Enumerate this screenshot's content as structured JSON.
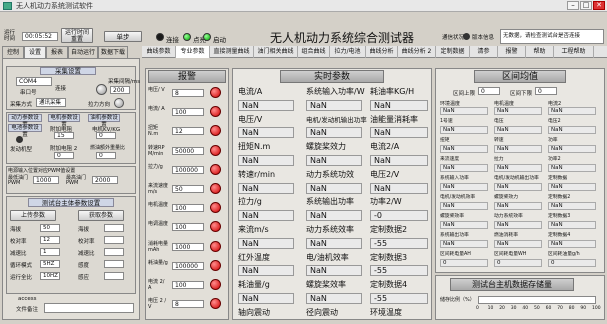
{
  "window": {
    "title": "无人机动力系统测试软件",
    "min": "–",
    "max": "□",
    "close": "✕"
  },
  "top": {
    "run_time_label": "运行时间",
    "run_time_value": "00:05:52",
    "reset_label": "运行时间 重置",
    "single_label": "单步",
    "connect_label": "连接",
    "light_label": "点亮",
    "start_label": "启动",
    "title": "无人机动力系统综合测试器",
    "comm_label": "通信状况",
    "version_label": "版本信息",
    "version_value": "无数据，请检查测试台是否连接"
  },
  "colors": {
    "accent": "#1aa41a",
    "alarm": "#d00000"
  },
  "left_tabs": [
    "控制",
    "设置",
    "报表",
    "自动运行",
    "数据下载"
  ],
  "right_tabs": [
    "曲线参数",
    "专业参数",
    "直接测量曲线",
    "油门相关曲线",
    "组合曲线",
    "拉力/电池",
    "曲线分析",
    "曲线分析 2",
    "定制数据",
    "清参",
    "报警",
    "帮助",
    "工程帮助"
  ],
  "left": {
    "sampling_title": "采集设置",
    "port_label": "串口号",
    "port_value": "COM4",
    "interval_label": "采集间隔/ms",
    "interval_value": "200",
    "connect_label": "连接",
    "mode_label": "采集方式",
    "mode_value": "通讯采集",
    "pull_label": "拉力方向",
    "power_title": "动力参数设置",
    "motor_label": "电机参数设置",
    "gas_label": "油机参数设置",
    "battery_label": "电池参数设置",
    "ext_pole_label": "附加电阻",
    "pole_value": "15",
    "kv_label": "电机KV/KG",
    "kv_value": "0",
    "engine_label": "发动机型",
    "ratio_label": "附加电阻 2",
    "ratio_value": "0",
    "gear_label": "燃油额外重量比",
    "gear_value": "0",
    "pwm_title": "电源输入位置对应PWM值设置",
    "pwm1_label": "最低油门 PWM",
    "pwm1_value": "1000",
    "pwm2_label": "最高油门 PWM",
    "pwm2_value": "2000",
    "eng_title": "测试台主体参数设置",
    "up_label": "上传参数",
    "down_label": "获取参数",
    "params": [
      {
        "l": "海拔",
        "v": "50"
      },
      {
        "l": "校对率",
        "v": "12"
      },
      {
        "l": "减速比",
        "v": "1"
      },
      {
        "l": "循环模式",
        "v": "5HZ"
      },
      {
        "l": "运行全比",
        "v": "10HZ"
      }
    ],
    "params2": [
      {
        "l": "海拔",
        "v": ""
      },
      {
        "l": "校对率",
        "v": ""
      },
      {
        "l": "减速比",
        "v": ""
      },
      {
        "l": "感度",
        "v": ""
      },
      {
        "l": "感应",
        "v": ""
      }
    ],
    "access_label": "access",
    "file_label": "文件备注"
  },
  "alarm": {
    "title": "报警",
    "items": [
      {
        "l": "电压/ V",
        "v": "8"
      },
      {
        "l": "电流/ A",
        "v": "100"
      },
      {
        "l": "扭矩 N.m",
        "v": "12"
      },
      {
        "l": "转速RP M/min",
        "v": "50000"
      },
      {
        "l": "拉力/g",
        "v": "100000"
      },
      {
        "l": "来流速度 m/s",
        "v": "50"
      },
      {
        "l": "电机温度",
        "v": "100"
      },
      {
        "l": "电调温度",
        "v": "100"
      },
      {
        "l": "消耗电量mAh",
        "v": "1000"
      },
      {
        "l": "耗油量/g",
        "v": "100000"
      },
      {
        "l": "电流 2/ A",
        "v": "100"
      },
      {
        "l": "电压 2 / V",
        "v": "8"
      }
    ]
  },
  "realtime": {
    "title": "实时参数",
    "rows": [
      [
        {
          "l": "电流/A",
          "v": ""
        },
        {
          "l": "系统输入功率/W",
          "v": ""
        },
        {
          "l": "耗油率KG/H",
          "v": ""
        }
      ],
      [
        {
          "l": "",
          "v": "NaN"
        },
        {
          "l": "",
          "v": "NaN"
        },
        {
          "l": "",
          "v": "NaN"
        }
      ],
      [
        {
          "l": "电压/V",
          "v": ""
        },
        {
          "l": "电机/发动机输出功率",
          "v": ""
        },
        {
          "l": "油能量消耗率",
          "v": ""
        }
      ],
      [
        {
          "l": "",
          "v": "NaN"
        },
        {
          "l": "",
          "v": "NaN"
        },
        {
          "l": "",
          "v": "NaN"
        }
      ],
      [
        {
          "l": "扭矩N.m",
          "v": ""
        },
        {
          "l": "螺旋桨效力",
          "v": ""
        },
        {
          "l": "电流2/A",
          "v": ""
        }
      ],
      [
        {
          "l": "",
          "v": "NaN"
        },
        {
          "l": "",
          "v": "NaN"
        },
        {
          "l": "",
          "v": "NaN"
        }
      ],
      [
        {
          "l": "转速r/min",
          "v": ""
        },
        {
          "l": "动力系统功效",
          "v": ""
        },
        {
          "l": "电压2/V",
          "v": ""
        }
      ],
      [
        {
          "l": "",
          "v": "NaN"
        },
        {
          "l": "",
          "v": "NaN"
        },
        {
          "l": "",
          "v": "NaN"
        }
      ],
      [
        {
          "l": "拉力/g",
          "v": ""
        },
        {
          "l": "系统输出功率",
          "v": ""
        },
        {
          "l": "功率2/W",
          "v": ""
        }
      ],
      [
        {
          "l": "",
          "v": "NaN"
        },
        {
          "l": "",
          "v": "NaN"
        },
        {
          "l": "",
          "v": "-0"
        }
      ],
      [
        {
          "l": "来流m/s",
          "v": ""
        },
        {
          "l": "动力系统效率",
          "v": ""
        },
        {
          "l": "定制数据2",
          "v": ""
        }
      ],
      [
        {
          "l": "",
          "v": "NaN"
        },
        {
          "l": "",
          "v": "NaN"
        },
        {
          "l": "",
          "v": "-55"
        }
      ],
      [
        {
          "l": "红外温度",
          "v": ""
        },
        {
          "l": "电/油机效率",
          "v": ""
        },
        {
          "l": "定制数据3",
          "v": ""
        }
      ],
      [
        {
          "l": "",
          "v": "NaN"
        },
        {
          "l": "",
          "v": "NaN"
        },
        {
          "l": "",
          "v": "-55"
        }
      ],
      [
        {
          "l": "耗油量/g",
          "v": ""
        },
        {
          "l": "螺旋桨效率",
          "v": ""
        },
        {
          "l": "定制数据4",
          "v": ""
        }
      ],
      [
        {
          "l": "",
          "v": "NaN"
        },
        {
          "l": "",
          "v": "NaN"
        },
        {
          "l": "",
          "v": "-55"
        }
      ],
      [
        {
          "l": "轴向震动",
          "v": ""
        },
        {
          "l": "径向震动",
          "v": ""
        },
        {
          "l": "环境温度",
          "v": ""
        }
      ]
    ]
  },
  "interval": {
    "title": "区间均值",
    "upper_label": "区间上限",
    "upper_value": "0",
    "lower_label": "区间下限",
    "lower_value": "0",
    "col_heads": [
      "环境温度",
      "电机温度",
      "电流2"
    ],
    "cells": [
      [
        "NaN",
        "NaN",
        "NaN"
      ],
      [
        "1号速",
        "电压",
        "电压2"
      ],
      [
        "NaN",
        "NaN",
        "NaN"
      ],
      [
        "扭矩",
        "转速",
        "功率"
      ],
      [
        "NaN",
        "NaN",
        "NaN"
      ],
      [
        "来流速度",
        "拉力",
        "功率2"
      ],
      [
        "NaN",
        "NaN",
        "NaN"
      ],
      [
        "系统输入功率",
        "电机/发动机输出功率",
        "定制数据"
      ],
      [
        "NaN",
        "NaN",
        "NaN"
      ],
      [
        "电机/发动机效率",
        "螺旋桨效力",
        "定制数据2"
      ],
      [
        "NaN",
        "NaN",
        "NaN"
      ],
      [
        "螺旋桨效率",
        "动力系统效率",
        "定制数据3"
      ],
      [
        "NaN",
        "NaN",
        "NaN"
      ],
      [
        "系统输出功率",
        "燃油消耗率",
        "定制数据4"
      ],
      [
        "NaN",
        "NaN",
        "NaN"
      ],
      [
        "区间耗电量AH",
        "区间耗电量WH",
        "区间耗油量g/h"
      ],
      [
        "0",
        "0",
        "0"
      ]
    ]
  },
  "storage": {
    "title": "测试台主机数据存储量",
    "usage_label": "储存比例（%）",
    "ticks": [
      "0",
      "10",
      "20",
      "30",
      "40",
      "50",
      "60",
      "70",
      "80",
      "90",
      "100"
    ],
    "value": "0"
  }
}
